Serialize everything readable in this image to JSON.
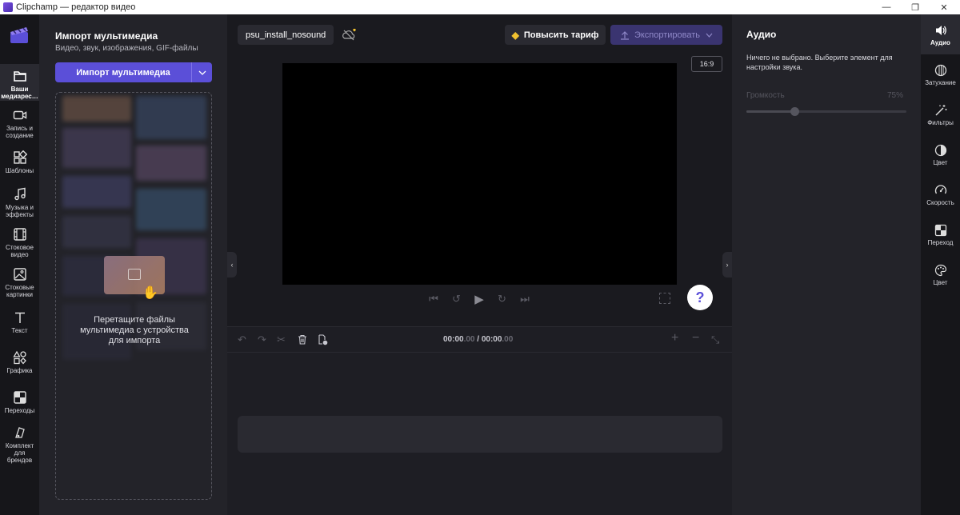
{
  "window": {
    "title": "Clipchamp — редактор видео",
    "minimize": "—",
    "maximize": "❐",
    "close": "✕"
  },
  "leftnav": {
    "items": [
      {
        "label": "Ваши\nмедиарес…",
        "icon": "folder-icon"
      },
      {
        "label": "Запись и\nсоздание",
        "icon": "camera-icon"
      },
      {
        "label": "Шаблоны",
        "icon": "templates-icon"
      },
      {
        "label": "Музыка и\nэффекты",
        "icon": "music-icon"
      },
      {
        "label": "Стоковое\nвидео",
        "icon": "film-icon"
      },
      {
        "label": "Стоковые\nкартинки",
        "icon": "image-icon"
      },
      {
        "label": "Текст",
        "icon": "text-icon"
      },
      {
        "label": "Графика",
        "icon": "shapes-icon"
      },
      {
        "label": "Переходы",
        "icon": "transitions-icon"
      },
      {
        "label": "Комплект\nдля\nбрендов",
        "icon": "brand-kit-icon"
      }
    ]
  },
  "media": {
    "title": "Импорт мультимедиа",
    "subtitle": "Видео, звук, изображения, GIF-файлы",
    "import_button": "Импорт мультимедиа",
    "dropdown": "⌄",
    "drop_text": "Перетащите файлы мультимедиа с устройства для импорта"
  },
  "editor": {
    "project_name": "psu_install_nosound",
    "upgrade_label": "Повысить тариф",
    "export_label": "Экспортировать",
    "aspect_ratio": "16:9",
    "help": "?",
    "collapse_left": "‹",
    "collapse_right": "›"
  },
  "timeline": {
    "current_time": "00:00",
    "current_frac": ".00",
    "separator": " / ",
    "total_time": "00:00",
    "total_frac": ".00"
  },
  "audio": {
    "title": "Аудио",
    "info": "Ничего не выбрано. Выберите элемент для настройки звука.",
    "volume_label": "Громкость",
    "volume_value": "75%",
    "volume_level": 0.75
  },
  "righttabs": {
    "items": [
      {
        "label": "Аудио",
        "icon": "speaker-icon"
      },
      {
        "label": "Затухание",
        "icon": "fade-icon"
      },
      {
        "label": "Фильтры",
        "icon": "wand-icon"
      },
      {
        "label": "Цвет",
        "icon": "contrast-icon"
      },
      {
        "label": "Скорость",
        "icon": "speedometer-icon"
      },
      {
        "label": "Переход",
        "icon": "transition-icon"
      },
      {
        "label": "Цвет",
        "icon": "palette-icon"
      }
    ]
  },
  "colors": {
    "accent": "#5b4fd8",
    "gem": "#f2c230",
    "background": "#1a1a1f",
    "panel": "#232329"
  }
}
